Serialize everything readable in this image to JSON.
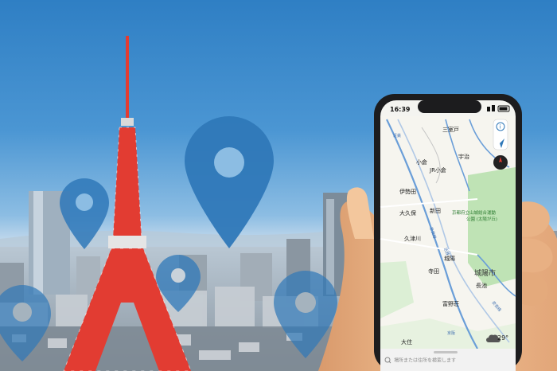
{
  "colors": {
    "sky_top": "#2f7fc4",
    "pin_blue": "#2f78b8",
    "map_green": "#bfe3b5",
    "road_blue": "#6a9ed8",
    "tower_red": "#e23c32"
  },
  "phone": {
    "status_time": "16:39",
    "weather": {
      "icon": "cloud-icon",
      "temp": "29°"
    },
    "search_placeholder": "場所または住所を検索します",
    "map_labels": {
      "mimurodo": "三室戸",
      "uji": "宇治",
      "ogura": "小倉",
      "jr_ogura": "JR小倉",
      "isedamachi": "伊勢田",
      "okubo": "大久保",
      "shinden": "新田",
      "kutsukawa": "久津川",
      "tera": "寺田",
      "joyo_station": "城陽",
      "park_line1": "京都府立山城総合運動",
      "park_line2": "公園 (太陽が丘)",
      "joyo_city": "城陽市",
      "nagaike": "長池",
      "tomino": "富野荘",
      "ohkubo_bottom": "大住",
      "route_kintetsu": "近鉄",
      "route_nara": "奈良線",
      "route_keihan": "京阪",
      "route_kintetsu2": "近鉄",
      "route_nara2": "奈良線"
    },
    "controls": {
      "info_icon": "info-icon",
      "location_icon": "location-arrow-icon",
      "compass_icon": "compass-icon"
    }
  }
}
